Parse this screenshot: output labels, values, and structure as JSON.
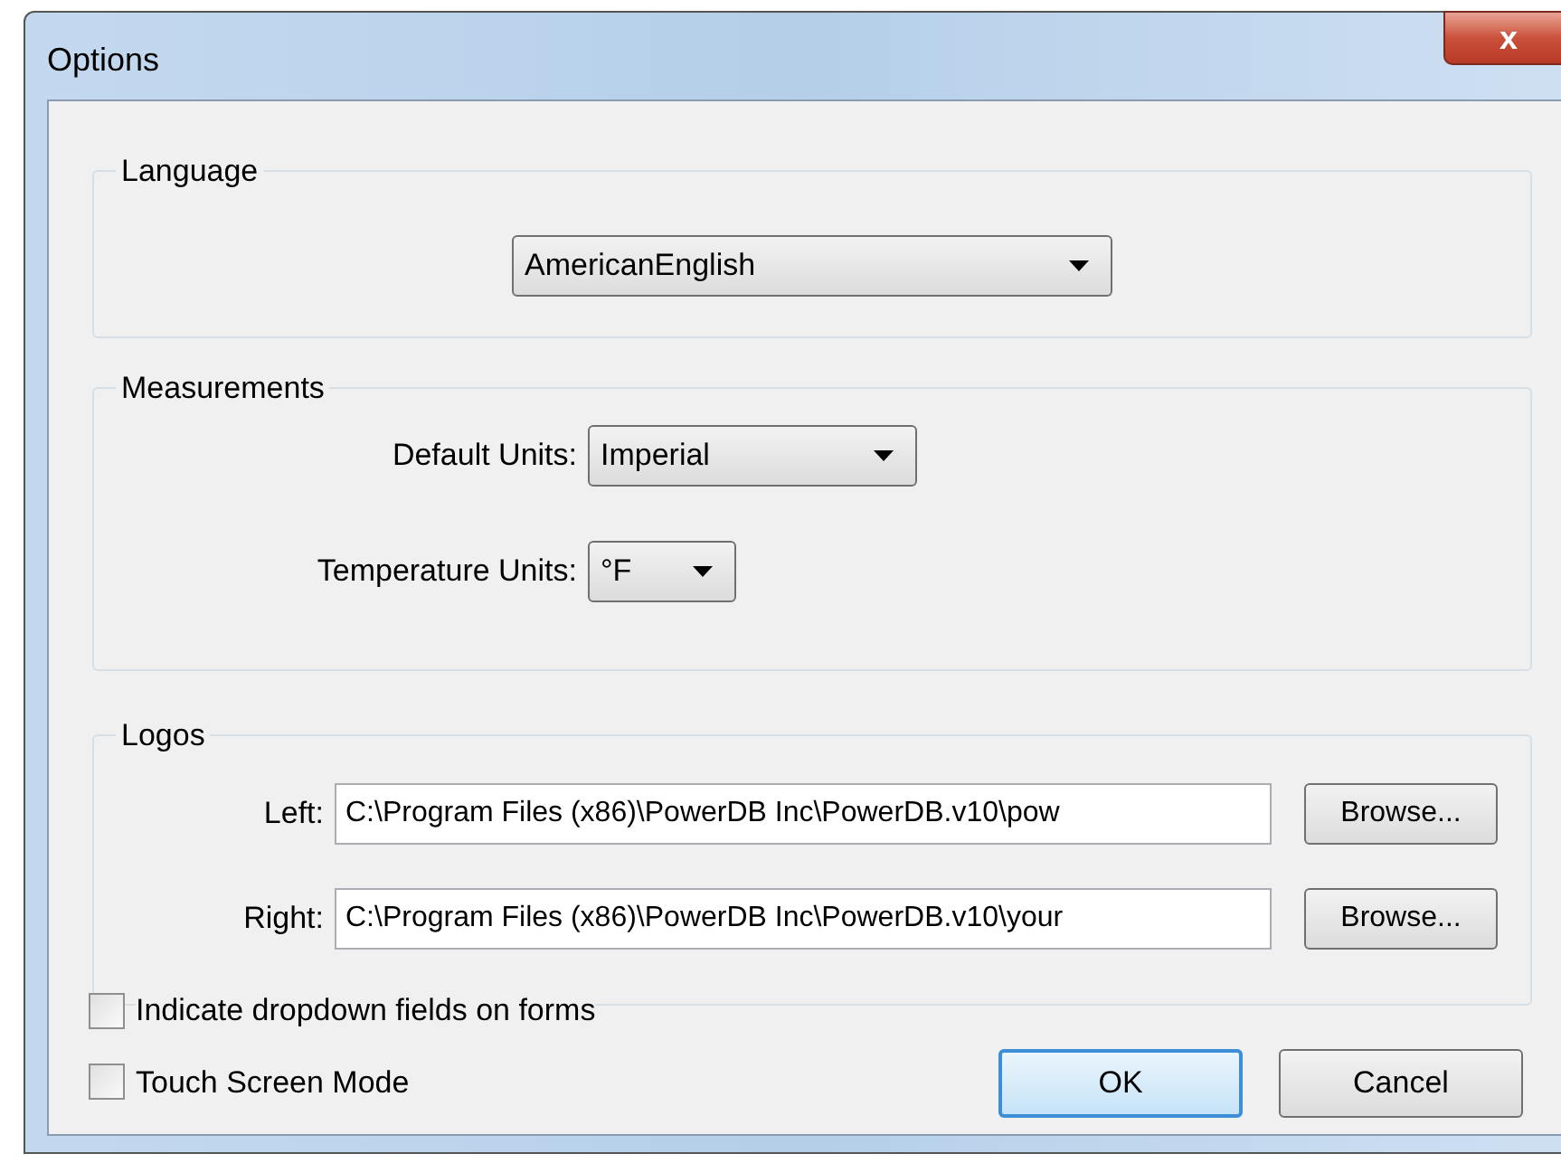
{
  "window": {
    "title": "Options",
    "close_label": "x"
  },
  "language": {
    "title": "Language",
    "value": "AmericanEnglish"
  },
  "measurements": {
    "title": "Measurements",
    "fields": [
      {
        "label": "Default Units:",
        "value": "Imperial"
      },
      {
        "label": "Temperature Units:",
        "value": "°F"
      }
    ]
  },
  "logos": {
    "title": "Logos",
    "fields": [
      {
        "label": "Left:",
        "value": "C:\\Program Files (x86)\\PowerDB Inc\\PowerDB.v10\\pow",
        "button": "Browse..."
      },
      {
        "label": "Right:",
        "value": "C:\\Program Files (x86)\\PowerDB Inc\\PowerDB.v10\\your",
        "button": "Browse..."
      }
    ]
  },
  "checkboxes": [
    {
      "label": "Indicate dropdown fields on forms",
      "checked": false
    },
    {
      "label": "Touch Screen Mode",
      "checked": false
    }
  ],
  "buttons": [
    {
      "label": "OK",
      "default": true
    },
    {
      "label": "Cancel",
      "default": false
    }
  ]
}
